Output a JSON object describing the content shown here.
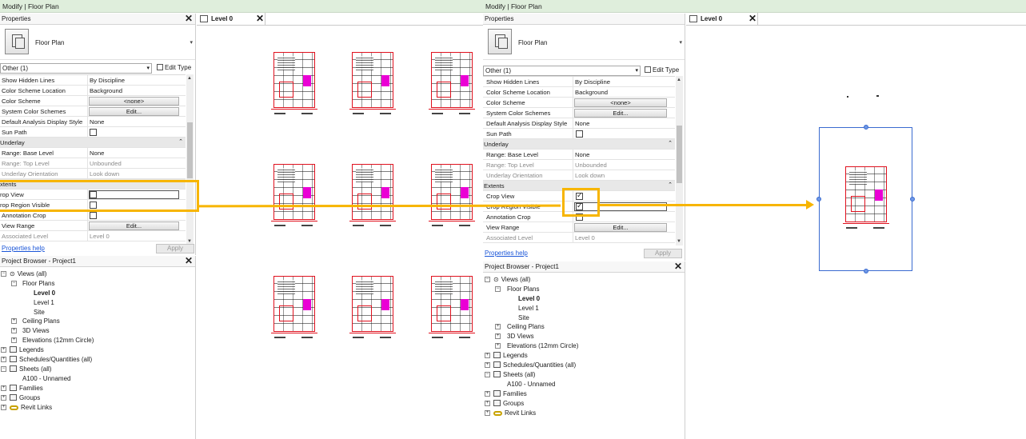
{
  "title_bar": "Modify | Floor Plan",
  "properties": {
    "header": "Properties",
    "type_name": "Floor Plan",
    "filter_left": "Other (1)",
    "filter_right": "Other (1)",
    "edit_type": "Edit Type",
    "rows": {
      "show_hidden_lines": {
        "label": "Show Hidden Lines",
        "value": "By Discipline"
      },
      "color_scheme_location": {
        "label": "Color Scheme Location",
        "value": "Background"
      },
      "color_scheme": {
        "label": "Color Scheme",
        "value": "<none>"
      },
      "system_color_schemes": {
        "label": "System Color Schemes",
        "value": "Edit..."
      },
      "default_analysis": {
        "label": "Default Analysis Display Style",
        "value": "None"
      },
      "sun_path": {
        "label": "Sun Path"
      },
      "underlay": {
        "label": "Underlay"
      },
      "range_base": {
        "label": "Range: Base Level",
        "value": "None"
      },
      "range_top": {
        "label": "Range: Top Level",
        "value": "Unbounded"
      },
      "underlay_orientation": {
        "label": "Underlay Orientation",
        "value": "Look down"
      },
      "extents_left": {
        "label": "xtents"
      },
      "extents_right": {
        "label": "Extents"
      },
      "crop_view_left": {
        "label": "rop View"
      },
      "crop_region_left": {
        "label": "rop Region Visible"
      },
      "crop_view_right": {
        "label": "Crop View",
        "checked": true
      },
      "crop_region_right": {
        "label": "Crop Region Visible",
        "checked": true
      },
      "annotation_crop": {
        "label": "Annotation Crop"
      },
      "view_range": {
        "label": "View Range",
        "value": "Edit..."
      },
      "associated_level": {
        "label": "Associated Level",
        "value": "Level 0"
      }
    },
    "help": "Properties help",
    "apply": "Apply"
  },
  "browser": {
    "header": "Project Browser - Project1",
    "views": "Views (all)",
    "floor_plans": "Floor Plans",
    "level0": "Level 0",
    "level1": "Level 1",
    "site": "Site",
    "ceiling": "Ceiling Plans",
    "views3d": "3D Views",
    "elevations": "Elevations (12mm Circle)",
    "legends": "Legends",
    "schedules": "Schedules/Quantities (all)",
    "sheets": "Sheets (all)",
    "a100": "A100 - Unnamed",
    "families": "Families",
    "groups": "Groups",
    "links": "Revit Links"
  },
  "view_tab": "Level 0",
  "tree_markers": {
    "open": "−",
    "closed": "+"
  },
  "glyphs": {
    "close": "✕",
    "dropdown": "▾",
    "collapse": "⌃",
    "scroll_up": "▲",
    "scroll_down": "▼",
    "target": "⊙"
  },
  "colors": {
    "highlight": "#f7b500",
    "crop_frame": "#3a6bd0",
    "plan_red": "#e0111e",
    "plan_magenta": "#ea00d5",
    "title_bar": "#dfeedc"
  },
  "icons": [
    "close-icon",
    "floor-plan-type-icon",
    "edit-type-icon",
    "view-tab-icon",
    "views-icon",
    "sheet-icon",
    "revit-link-icon"
  ]
}
